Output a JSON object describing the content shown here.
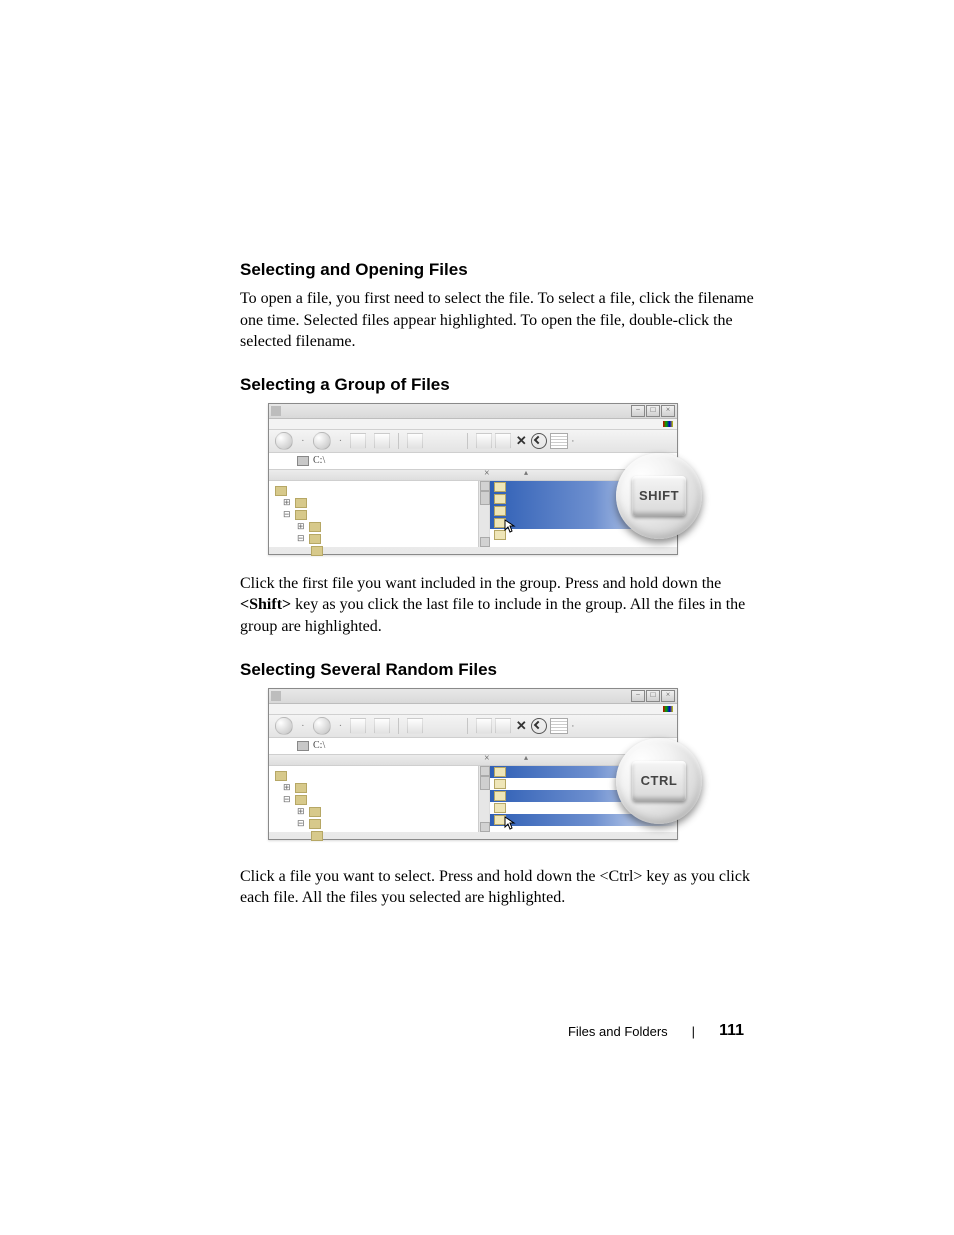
{
  "headings": {
    "h1": "Selecting and Opening Files",
    "h2": "Selecting a Group of Files",
    "h3": "Selecting Several Random Files"
  },
  "paragraphs": {
    "p1": "To open a file, you first need to select the file. To select a file, click the filename one time. Selected files appear highlighted. To open the file, double-click the selected filename.",
    "p2a": "Click the first file you want included in the group. Press and hold down the ",
    "p2b": "<Shift>",
    "p2c": " key as you click the last file to include in the group. All the files in the group are highlighted.",
    "p3": "Click a file you want to select. Press and hold down the <Ctrl> key as you click each file. All the files you selected are highlighted."
  },
  "figure1": {
    "address": "C:\\",
    "key_label": "SHIFT",
    "rows_selected": [
      true,
      true,
      true,
      true
    ],
    "rows_unselected_after": 1
  },
  "figure2": {
    "address": "C:\\",
    "key_label": "CTRL",
    "row_pattern": [
      true,
      false,
      true,
      false,
      true
    ]
  },
  "footer": {
    "section": "Files and Folders",
    "page": "111"
  }
}
